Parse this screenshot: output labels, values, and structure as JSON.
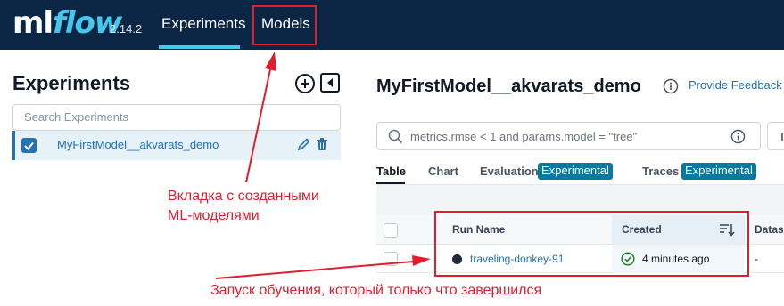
{
  "topnav": {
    "logo_ml": "ml",
    "logo_flow": "flow",
    "version": "2.14.2",
    "tabs": [
      {
        "label": "Experiments",
        "active": true
      },
      {
        "label": "Models",
        "active": false
      }
    ]
  },
  "sidebar": {
    "title": "Experiments",
    "search_placeholder": "Search Experiments",
    "experiments": [
      {
        "name": "MyFirstModel__akvarats_demo",
        "selected": true
      }
    ]
  },
  "annotations": {
    "models_note_line1": "Вкладка с созданными",
    "models_note_line2": "ML-моделями",
    "run_note": "Запуск обучения, который только что завершился",
    "color": "#e11d2e"
  },
  "main": {
    "experiment_title": "MyFirstModel__akvarats_demo",
    "feedback_link": "Provide Feedback",
    "search_text": "metrics.rmse < 1 and params.model = \"tree\"",
    "extra_box_text": "T",
    "tabs": [
      {
        "label": "Table",
        "active": true
      },
      {
        "label": "Chart"
      },
      {
        "label": "Evaluation",
        "badge": "Experimental"
      },
      {
        "label": "Traces",
        "badge": "Experimental"
      }
    ],
    "table": {
      "columns": [
        "Run Name",
        "Created",
        "Datase"
      ],
      "rows": [
        {
          "run_name": "traveling-donkey-91",
          "created": "4 minutes ago",
          "dataset": "-",
          "status": "finished"
        }
      ]
    }
  },
  "colors": {
    "topbar": "#0b2545",
    "accent": "#43c9ed",
    "link": "#2272b4",
    "badge": "#077a9d",
    "success": "#2e7d32"
  },
  "icons": [
    "plus-circle-icon",
    "collapse-sidebar-icon",
    "checkbox-checked-icon",
    "pencil-icon",
    "trash-icon",
    "info-icon",
    "search-icon",
    "sort-icon",
    "check-circle-icon"
  ]
}
